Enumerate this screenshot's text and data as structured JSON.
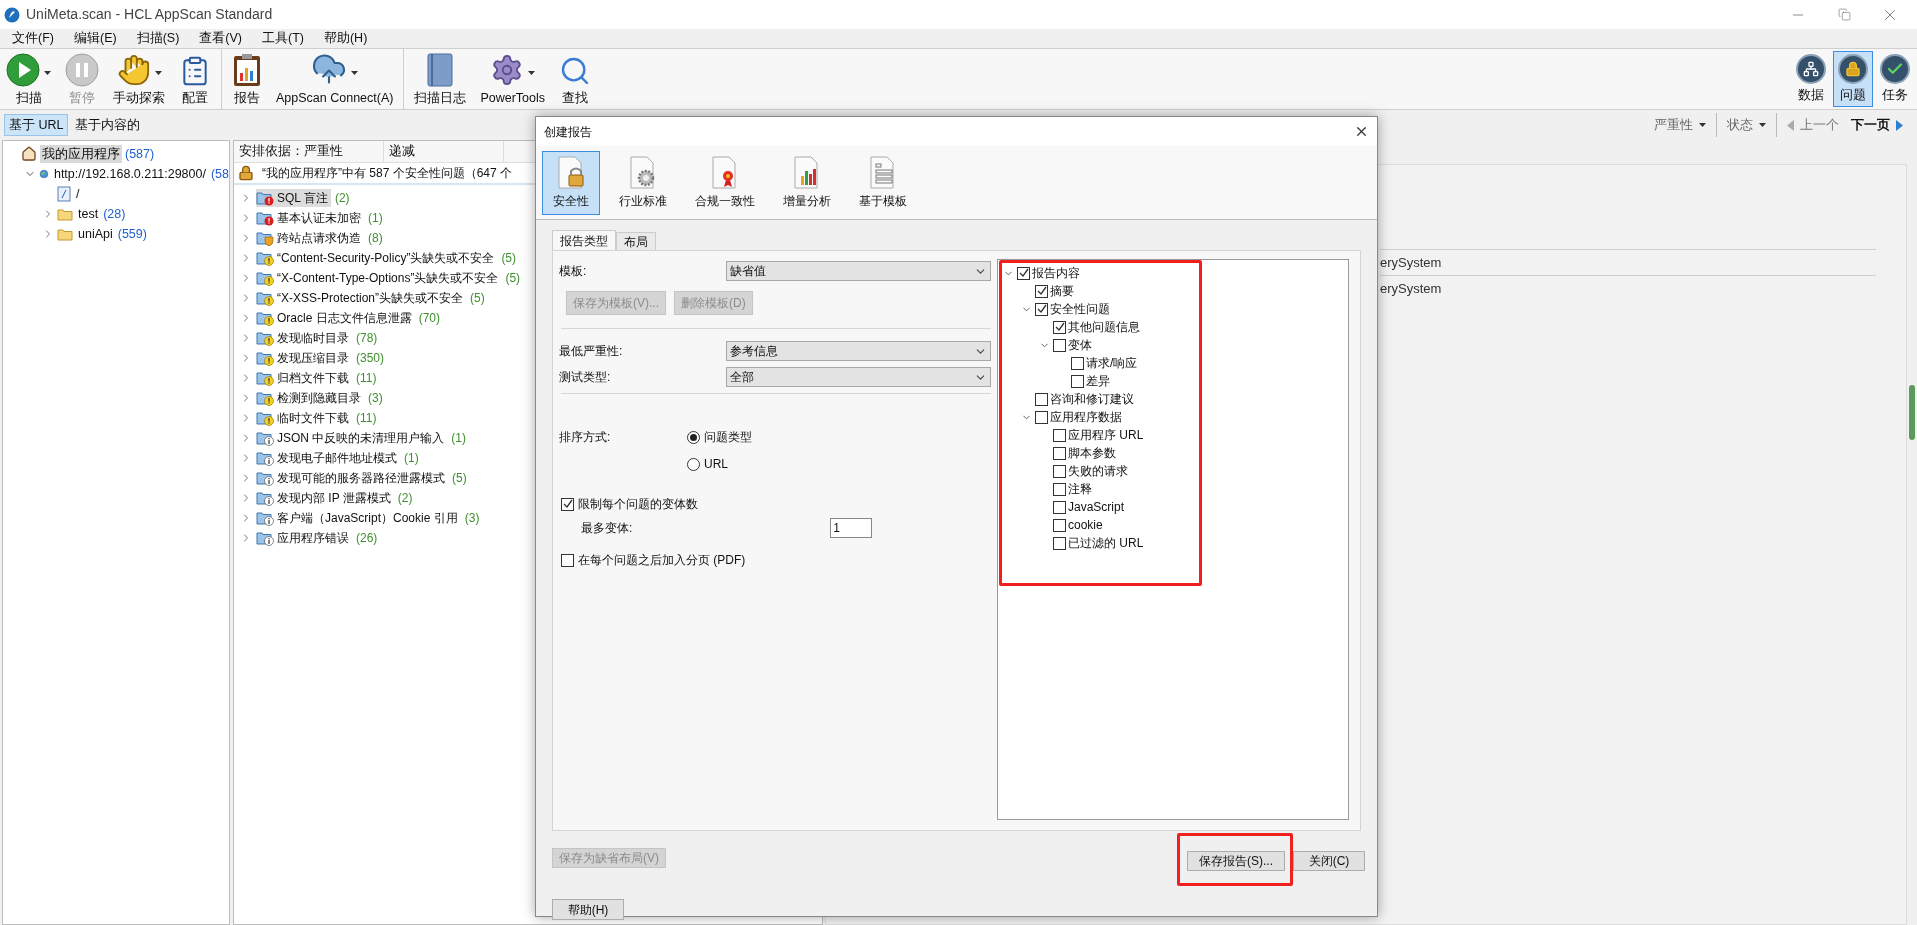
{
  "window": {
    "title": "UniMeta.scan - HCL AppScan Standard"
  },
  "menu": [
    "文件(F)",
    "编辑(E)",
    "扫描(S)",
    "查看(V)",
    "工具(T)",
    "帮助(H)"
  ],
  "toolbar": [
    {
      "items": [
        {
          "label": "扫描",
          "kind": "play",
          "dropdown": true,
          "disabled": false
        },
        {
          "label": "暂停",
          "kind": "pause",
          "dropdown": false,
          "disabled": true
        },
        {
          "label": "手动探索",
          "kind": "hand",
          "dropdown": true,
          "disabled": false
        },
        {
          "label": "配置",
          "kind": "checklist",
          "dropdown": false,
          "disabled": false
        }
      ]
    },
    {
      "items": [
        {
          "label": "报告",
          "kind": "report",
          "dropdown": false,
          "disabled": false
        },
        {
          "label": "AppScan Connect(A)",
          "kind": "cloud",
          "dropdown": true,
          "disabled": false
        }
      ]
    },
    {
      "items": [
        {
          "label": "扫描日志",
          "kind": "log",
          "dropdown": false,
          "disabled": false
        },
        {
          "label": "PowerTools",
          "kind": "gear",
          "dropdown": true,
          "disabled": false
        },
        {
          "label": "查找",
          "kind": "search",
          "dropdown": false,
          "disabled": false
        }
      ]
    }
  ],
  "view_switcher": [
    {
      "label": "数据",
      "kind": "data",
      "selected": false
    },
    {
      "label": "问题",
      "kind": "issues",
      "selected": true
    },
    {
      "label": "任务",
      "kind": "tasks",
      "selected": false
    }
  ],
  "view_tabs": [
    {
      "label": "基于 URL",
      "selected": true
    },
    {
      "label": "基于内容的",
      "selected": false
    }
  ],
  "tree": [
    {
      "label": "我的应用程序",
      "count": "(587)",
      "kind": "root",
      "selected": true,
      "children": [
        {
          "label": "http://192.168.0.211:29800/",
          "count": "(58",
          "kind": "site",
          "selected": false,
          "expanded": true,
          "children": [
            {
              "label": "/",
              "kind": "page",
              "selected": false
            },
            {
              "label": "test",
              "count": "(28)",
              "kind": "folder",
              "selected": false,
              "expanded": false
            },
            {
              "label": "uniApi",
              "count": "(559)",
              "kind": "folder",
              "selected": false,
              "expanded": false
            }
          ]
        }
      ]
    }
  ],
  "issues": {
    "columns": [
      "安排依据：严重性",
      "递减"
    ],
    "summary": "“我的应用程序”中有 587 个安全性问题（647 个",
    "items": [
      {
        "label": "SQL 盲注",
        "count": "(2)",
        "kind": "high",
        "selected": true
      },
      {
        "label": "基本认证未加密",
        "count": "(1)",
        "kind": "high",
        "selected": false
      },
      {
        "label": "跨站点请求伪造",
        "count": "(8)",
        "kind": "medium",
        "selected": false
      },
      {
        "label": "“Content-Security-Policy”头缺失或不安全",
        "count": "(5)",
        "kind": "low",
        "selected": false
      },
      {
        "label": "“X-Content-Type-Options”头缺失或不安全",
        "count": "(5)",
        "kind": "low",
        "selected": false
      },
      {
        "label": "“X-XSS-Protection”头缺失或不安全",
        "count": "(5)",
        "kind": "low",
        "selected": false
      },
      {
        "label": "Oracle 日志文件信息泄露",
        "count": "(70)",
        "kind": "low",
        "selected": false
      },
      {
        "label": "发现临时目录",
        "count": "(78)",
        "kind": "low",
        "selected": false
      },
      {
        "label": "发现压缩目录",
        "count": "(350)",
        "kind": "low",
        "selected": false
      },
      {
        "label": "归档文件下载",
        "count": "(11)",
        "kind": "low",
        "selected": false
      },
      {
        "label": "检测到隐藏目录",
        "count": "(3)",
        "kind": "low",
        "selected": false
      },
      {
        "label": "临时文件下载",
        "count": "(11)",
        "kind": "low",
        "selected": false
      },
      {
        "label": "JSON 中反映的未清理用户输入",
        "count": "(1)",
        "kind": "info",
        "selected": false
      },
      {
        "label": "发现电子邮件地址模式",
        "count": "(1)",
        "kind": "info",
        "selected": false
      },
      {
        "label": "发现可能的服务器路径泄露模式",
        "count": "(5)",
        "kind": "info",
        "selected": false
      },
      {
        "label": "发现内部 IP 泄露模式",
        "count": "(2)",
        "kind": "info",
        "selected": false
      },
      {
        "label": "客户端（JavaScript）Cookie 引用",
        "count": "(3)",
        "kind": "info",
        "selected": false
      },
      {
        "label": "应用程序错误",
        "count": "(26)",
        "kind": "info",
        "selected": false
      }
    ]
  },
  "right_pane": {
    "filters": [
      "严重性",
      "状态"
    ],
    "prev": {
      "label": "上一个",
      "disabled": true
    },
    "next": {
      "label": "下一页",
      "disabled": false
    },
    "rows": [
      "erySystem",
      "erySystem"
    ]
  },
  "dialog": {
    "title": "创建报告",
    "report_types": [
      {
        "label": "安全性",
        "kind": "security",
        "selected": true
      },
      {
        "label": "行业标准",
        "kind": "industry",
        "selected": false
      },
      {
        "label": "合规一致性",
        "kind": "compliance",
        "selected": false
      },
      {
        "label": "增量分析",
        "kind": "delta",
        "selected": false
      },
      {
        "label": "基于模板",
        "kind": "template",
        "selected": false
      }
    ],
    "tabs": [
      {
        "label": "报告类型",
        "selected": true
      },
      {
        "label": "布局",
        "selected": false
      }
    ],
    "template": {
      "label": "模板:",
      "value": "缺省值"
    },
    "template_buttons": [
      {
        "label": "保存为模板(V)...",
        "disabled": true
      },
      {
        "label": "删除模板(D)",
        "disabled": true
      }
    ],
    "min_severity": {
      "label": "最低严重性:",
      "value": "参考信息"
    },
    "test_type": {
      "label": "测试类型:",
      "value": "全部"
    },
    "sort": {
      "label": "排序方式:",
      "options": [
        {
          "label": "问题类型",
          "selected": true
        },
        {
          "label": "URL",
          "selected": false
        }
      ]
    },
    "limit_variants": {
      "label": "限制每个问题的变体数",
      "checked": true
    },
    "max_variants": {
      "label": "最多变体:",
      "value": "1"
    },
    "page_break": {
      "label": "在每个问题之后加入分页 (PDF)",
      "checked": false
    },
    "content_tree": [
      {
        "label": "报告内容",
        "checked": true,
        "expanded": true,
        "children": [
          {
            "label": "摘要",
            "checked": true
          },
          {
            "label": "安全性问题",
            "checked": true,
            "expanded": true,
            "children": [
              {
                "label": "其他问题信息",
                "checked": true
              },
              {
                "label": "变体",
                "checked": false,
                "expanded": true,
                "children": [
                  {
                    "label": "请求/响应",
                    "checked": false
                  },
                  {
                    "label": "差异",
                    "checked": false
                  }
                ]
              }
            ]
          },
          {
            "label": "咨询和修订建议",
            "checked": false
          },
          {
            "label": "应用程序数据",
            "checked": false,
            "expanded": true,
            "children": [
              {
                "label": "应用程序 URL",
                "checked": false
              },
              {
                "label": "脚本参数",
                "checked": false
              },
              {
                "label": "失败的请求",
                "checked": false
              },
              {
                "label": "注释",
                "checked": false
              },
              {
                "label": "JavaScript",
                "checked": false
              },
              {
                "label": "cookie",
                "checked": false
              },
              {
                "label": "已过滤的 URL",
                "checked": false
              }
            ]
          }
        ]
      }
    ],
    "save_layout": {
      "label": "保存为缺省布局(V)",
      "disabled": true
    },
    "buttons": [
      {
        "label": "保存报告(S)...",
        "kind": "save"
      },
      {
        "label": "关闭(C)",
        "kind": "close"
      }
    ],
    "help": "帮助(H)"
  }
}
